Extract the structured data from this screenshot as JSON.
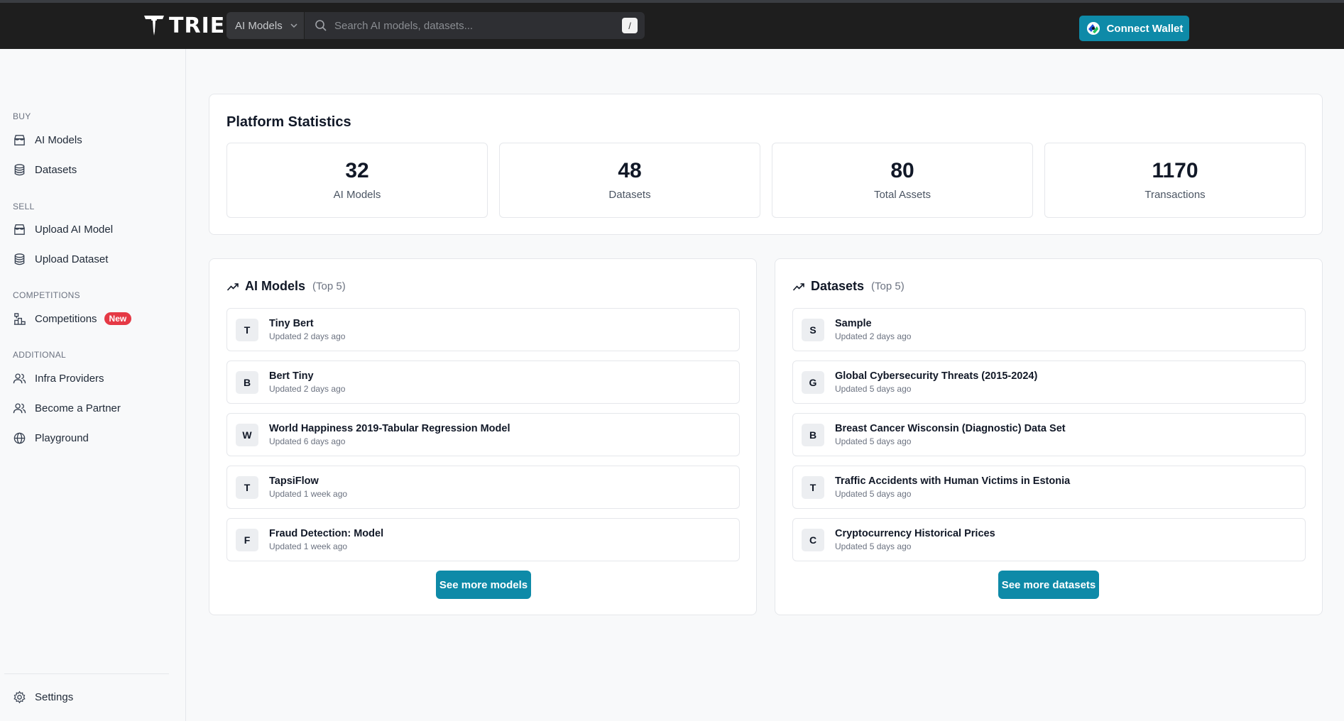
{
  "header": {
    "brand": "TRIE",
    "category_select": "AI Models",
    "search_placeholder": "Search AI models, datasets...",
    "search_shortcut": "/",
    "connect_wallet": "Connect Wallet"
  },
  "sidebar": {
    "sections": {
      "buy": "BUY",
      "sell": "SELL",
      "competitions": "COMPETITIONS",
      "additional": "ADDITIONAL"
    },
    "items": {
      "ai_models": "AI Models",
      "datasets": "Datasets",
      "upload_model": "Upload AI Model",
      "upload_dataset": "Upload Dataset",
      "competitions": "Competitions",
      "competitions_badge": "New",
      "infra_providers": "Infra Providers",
      "become_partner": "Become a Partner",
      "playground": "Playground",
      "settings": "Settings"
    }
  },
  "stats": {
    "title": "Platform Statistics",
    "items": [
      {
        "value": "32",
        "label": "AI Models"
      },
      {
        "value": "48",
        "label": "Datasets"
      },
      {
        "value": "80",
        "label": "Total Assets"
      },
      {
        "value": "1170",
        "label": "Transactions"
      }
    ]
  },
  "models": {
    "title": "AI Models",
    "subtitle": "(Top 5)",
    "items": [
      {
        "initial": "T",
        "name": "Tiny Bert",
        "updated": "Updated 2 days ago"
      },
      {
        "initial": "B",
        "name": "Bert Tiny",
        "updated": "Updated 2 days ago"
      },
      {
        "initial": "W",
        "name": "World Happiness 2019-Tabular Regression Model",
        "updated": "Updated 6 days ago"
      },
      {
        "initial": "T",
        "name": "TapsiFlow",
        "updated": "Updated 1 week ago"
      },
      {
        "initial": "F",
        "name": "Fraud Detection: Model",
        "updated": "Updated 1 week ago"
      }
    ],
    "more_button": "See more models"
  },
  "datasets": {
    "title": "Datasets",
    "subtitle": "(Top 5)",
    "items": [
      {
        "initial": "S",
        "name": "Sample",
        "updated": "Updated 2 days ago"
      },
      {
        "initial": "G",
        "name": "Global Cybersecurity Threats (2015-2024)",
        "updated": "Updated 5 days ago"
      },
      {
        "initial": "B",
        "name": "Breast Cancer Wisconsin (Diagnostic) Data Set",
        "updated": "Updated 5 days ago"
      },
      {
        "initial": "T",
        "name": "Traffic Accidents with Human Victims in Estonia",
        "updated": "Updated 5 days ago"
      },
      {
        "initial": "C",
        "name": "Cryptocurrency Historical Prices",
        "updated": "Updated 5 days ago"
      }
    ],
    "more_button": "See more datasets"
  },
  "colors": {
    "accent": "#0e8aa8",
    "topbar": "#1e1e1e",
    "badge": "#e53945"
  }
}
